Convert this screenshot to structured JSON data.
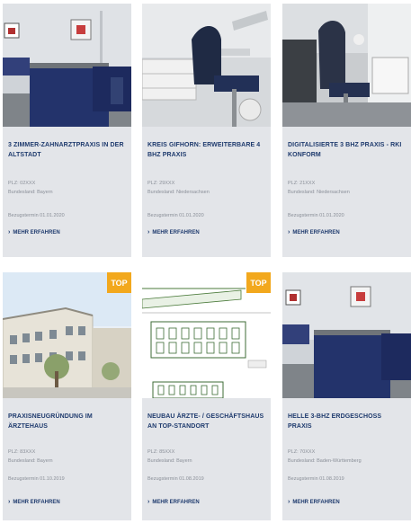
{
  "cards": [
    {
      "title": "3 Zimmer-Zahnarztpraxis in der Altstadt",
      "plz": "PLZ: 02XXX",
      "land": "Bundesland: Bayern",
      "termin": "Bezugstermin 01.01.2020",
      "more": "MEHR ERFAHREN",
      "top": false
    },
    {
      "title": "Kreis Gifhorn: erweiterbare 4 BHZ Praxis",
      "plz": "PLZ: 29XXX",
      "land": "Bundesland: Niedersachsen",
      "termin": "Bezugstermin 01.01.2020",
      "more": "MEHR ERFAHREN",
      "top": false
    },
    {
      "title": "Digitalisierte 3 BHZ Praxis - RKI konform",
      "plz": "PLZ: 21XXX",
      "land": "Bundesland: Niedersachsen",
      "termin": "Bezugstermin 01.01.2020",
      "more": "MEHR ERFAHREN",
      "top": false
    },
    {
      "title": "Praxisneugründung im Ärztehaus",
      "plz": "PLZ: 83XXX",
      "land": "Bundesland: Bayern",
      "termin": "Bezugstermin 01.10.2019",
      "more": "MEHR ERFAHREN",
      "top": true,
      "badge": "TOP"
    },
    {
      "title": "Neubau Ärzte- / Geschäftshaus an Top-Standort",
      "plz": "PLZ: 85XXX",
      "land": "Bundesland: Bayern",
      "termin": "Bezugstermin 01.08.2019",
      "more": "MEHR ERFAHREN",
      "top": true,
      "badge": "TOP"
    },
    {
      "title": "Helle 3-BHZ Erdgeschoss Praxis",
      "plz": "PLZ: 70XXX",
      "land": "Bundesland: Baden-Württemberg",
      "termin": "Bezugstermin 01.08.2019",
      "more": "MEHR ERFAHREN",
      "top": false
    }
  ],
  "colors": {
    "title": "#1f3b6e",
    "card_bg": "#e3e5e9",
    "badge": "#f2a81d",
    "meta": "#8a8f98"
  },
  "icons": {
    "more": "chevron-right-icon"
  }
}
